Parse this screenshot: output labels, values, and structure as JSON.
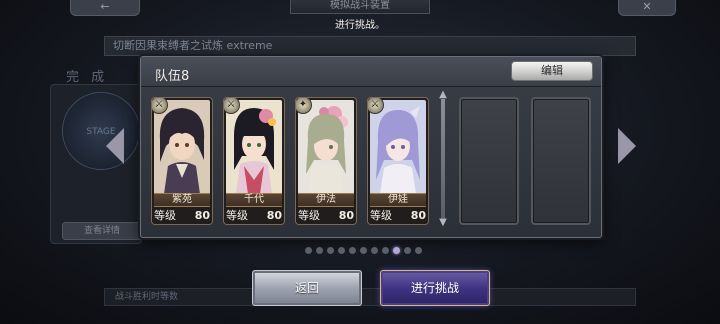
{
  "background": {
    "top_left_button": "←",
    "top_right_button": "✕",
    "title_plate": "模拟战斗装置",
    "subtitle": "进行挑战。",
    "quest_name": "切断因果束缚者之试炼 extreme",
    "complete_text": "完 成",
    "stage_label": "STAGE",
    "info_button": "查看详情",
    "bottom_bar": "战斗胜利时等数"
  },
  "team": {
    "title": "队伍8",
    "edit_label": "编辑",
    "level_label": "等级",
    "members": [
      {
        "name": "紫苑",
        "level": "80",
        "class_icon": "sword-class-icon"
      },
      {
        "name": "千代",
        "level": "80",
        "class_icon": "sword-class-icon"
      },
      {
        "name": "伊法",
        "level": "80",
        "class_icon": "staff-class-icon"
      },
      {
        "name": "伊娃",
        "level": "80",
        "class_icon": "sword-class-icon"
      }
    ],
    "empty_slots": 2
  },
  "pager": {
    "total": 11,
    "active_index": 8
  },
  "buttons": {
    "back_label": "返回",
    "start_label": "进行挑战"
  },
  "colors": {
    "accent_purple": "#3f3480",
    "gold_border": "#d6be7a",
    "card_border": "#7d6a55"
  }
}
